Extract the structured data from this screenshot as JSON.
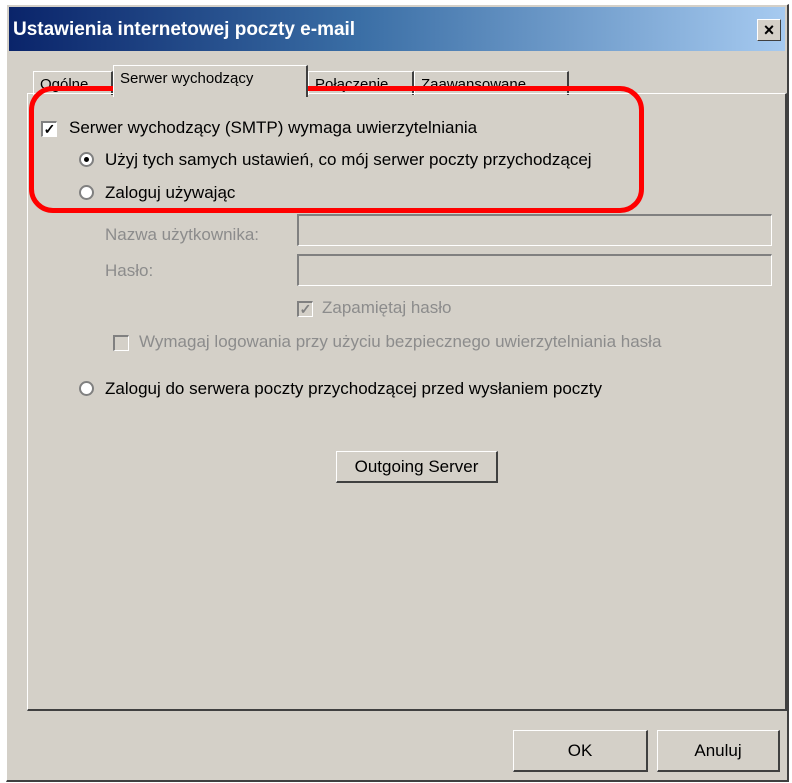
{
  "window": {
    "title": "Ustawienia internetowej poczty e-mail",
    "close_label": "×"
  },
  "tabs": [
    {
      "label": "Ogólne",
      "active": false
    },
    {
      "label": "Serwer wychodzący",
      "active": true
    },
    {
      "label": "Połączenie",
      "active": false
    },
    {
      "label": "Zaawansowane",
      "active": false
    }
  ],
  "outgoing": {
    "smtp_auth_label": "Serwer wychodzący (SMTP) wymaga uwierzytelniania",
    "smtp_auth_checked": true,
    "use_same_label": "Użyj tych samych ustawień, co mój serwer poczty przychodzącej",
    "use_same_selected": true,
    "login_using_label": "Zaloguj używając",
    "username_label": "Nazwa użytkownika:",
    "username_value": "",
    "password_label": "Hasło:",
    "password_value": "",
    "remember_password_label": "Zapamiętaj hasło",
    "remember_password_checked": true,
    "spa_label": "Wymagaj logowania przy użyciu bezpiecznego uwierzytelniania hasła",
    "spa_checked": false,
    "login_before_send_label": "Zaloguj do serwera poczty przychodzącej przed wysłaniem poczty",
    "outgoing_server_button": "Outgoing Server"
  },
  "footer": {
    "ok_label": "OK",
    "cancel_label": "Anuluj"
  },
  "colors": {
    "highlight": "#ff0000",
    "title_bar": "#0a246a"
  }
}
